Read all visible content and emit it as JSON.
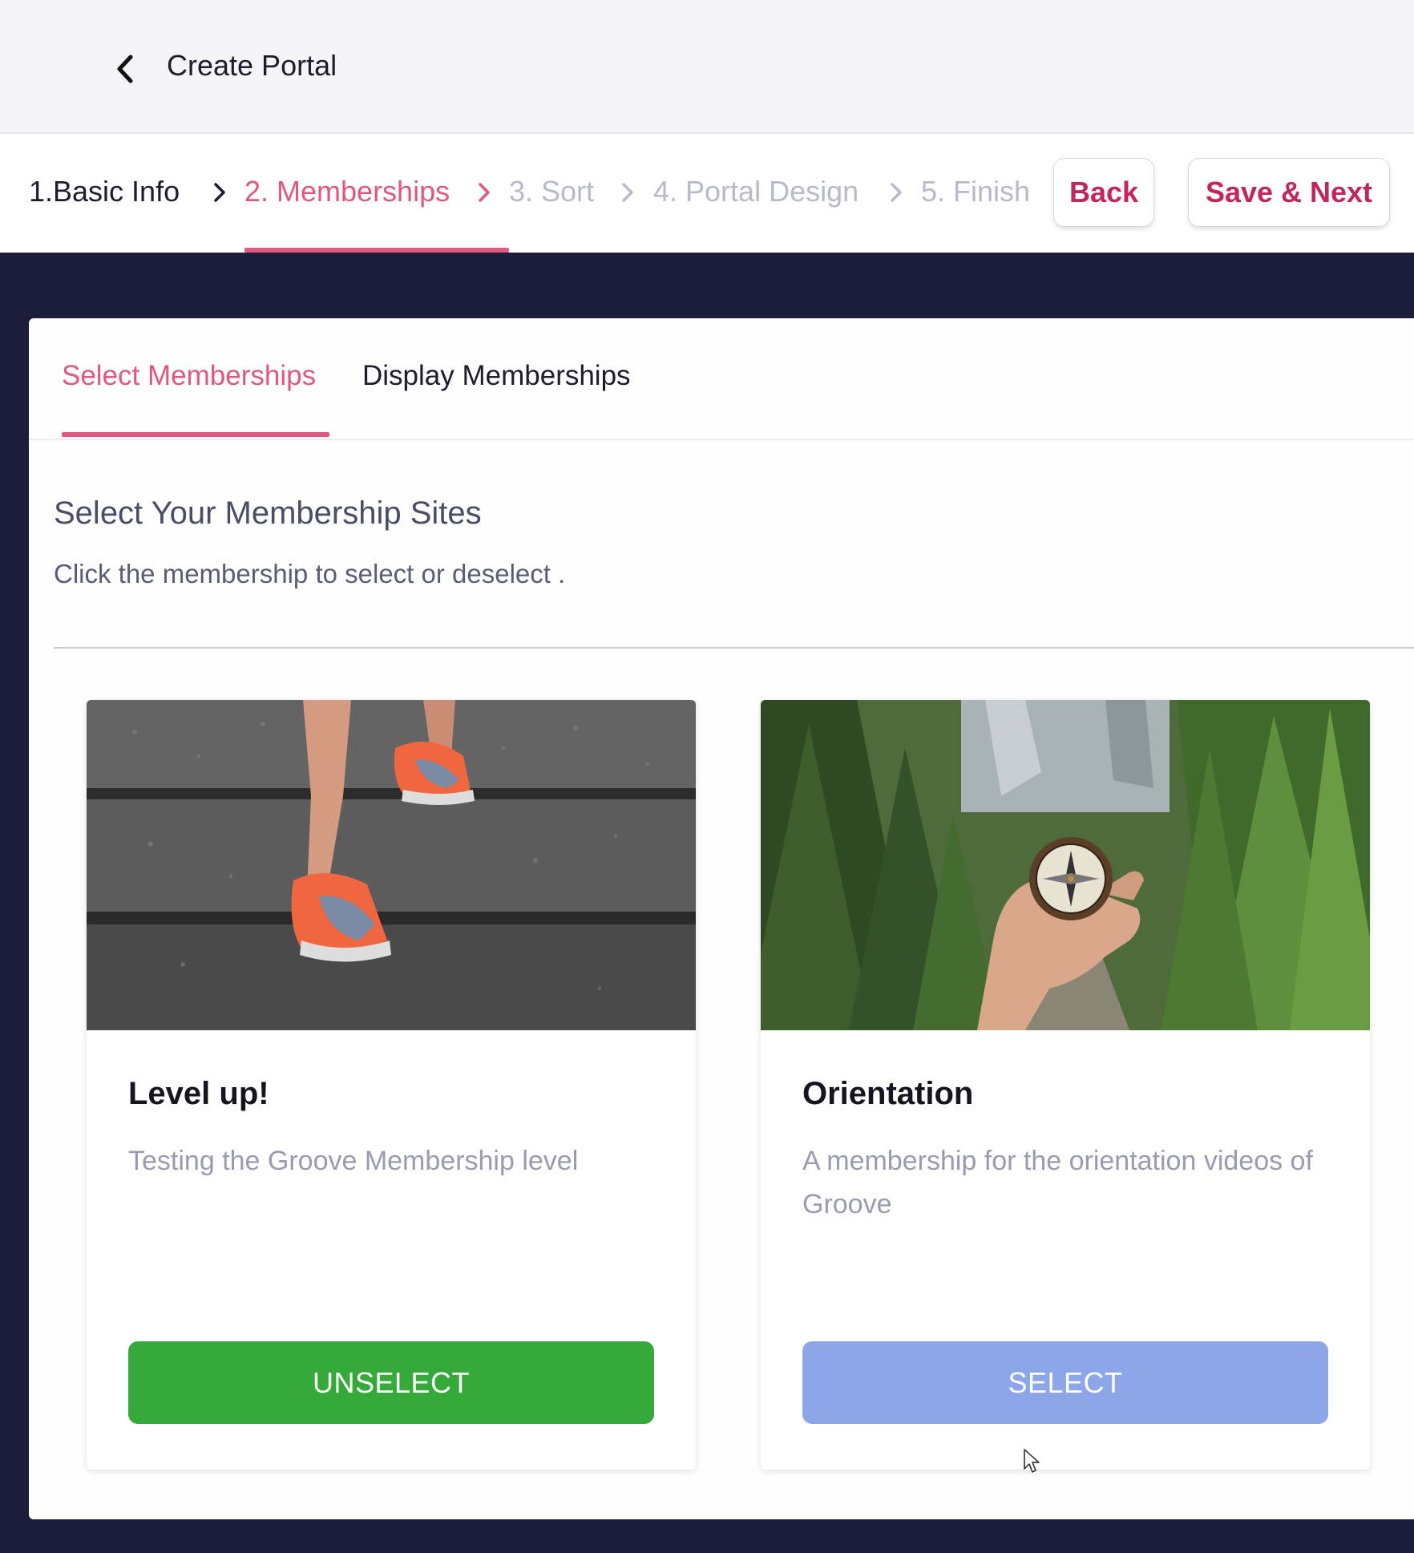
{
  "header": {
    "title": "Create Portal",
    "back_icon": "chevron-left-icon"
  },
  "steps": [
    {
      "label": "1.Basic Info",
      "state": "done"
    },
    {
      "label": "2. Memberships",
      "state": "active"
    },
    {
      "label": "3. Sort",
      "state": "todo"
    },
    {
      "label": "4. Portal Design",
      "state": "todo"
    },
    {
      "label": "5. Finish",
      "state": "todo"
    }
  ],
  "actions": {
    "back_label": "Back",
    "save_next_label": "Save & Next"
  },
  "tabs": [
    {
      "label": "Select Memberships",
      "active": true
    },
    {
      "label": "Display Memberships",
      "active": false
    }
  ],
  "section": {
    "title": "Select Your Membership Sites",
    "subtitle": "Click the membership to select or deselect ."
  },
  "memberships": [
    {
      "title": "Level up!",
      "description": "Testing the Groove Membership level",
      "button_label": "UNSELECT",
      "selected": true,
      "image": "running-shoes-stairs-photo"
    },
    {
      "title": "Orientation",
      "description": "A membership for the orientation videos of Groove",
      "button_label": "SELECT",
      "selected": false,
      "image": "compass-forest-photo"
    }
  ],
  "colors": {
    "accent": "#e0587f",
    "button_text": "#c2265c",
    "background": "#1c1d3b",
    "unselect_green": "#36a93b",
    "select_blue": "#8da6ea"
  }
}
